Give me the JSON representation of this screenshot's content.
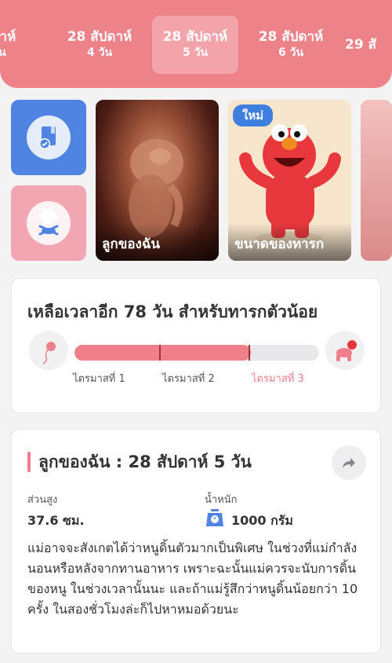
{
  "week_tabs": [
    {
      "line1": "ปดาห์",
      "line2": "วัน"
    },
    {
      "line1": "28 สัปดาห์",
      "line2": "4 วัน"
    },
    {
      "line1": "28 สัปดาห์",
      "line2": "5 วัน"
    },
    {
      "line1": "28 สัปดาห์",
      "line2": "6 วัน"
    },
    {
      "line1": "29 สั",
      "line2": ""
    }
  ],
  "active_tab_index": 2,
  "cards": {
    "fetus_caption": "ลูกของฉัน",
    "size_caption": "ขนาดของทารก",
    "new_badge": "ใหม่"
  },
  "countdown": {
    "title": "เหลือเวลาอีก 78 วัน สำหรับทารกตัวน้อย",
    "trimesters": [
      "ไตรมาสที่ 1",
      "ไตรมาสที่ 2",
      "ไตรมาสที่ 3"
    ],
    "progress_fraction": 0.72,
    "current_trimester_index": 2
  },
  "info": {
    "heading": "ลูกของฉัน : 28 สัปดาห์ 5  วัน",
    "height_label": "ส่วนสูง",
    "height_value": "37.6 ซม.",
    "weight_label": "น้ำหนัก",
    "weight_value": "1000 กรัม",
    "description": "แม่อาจจะสังเกตได้ว่าหนูดิ้นตัวมากเป็นพิเศษ ในช่วงที่แม่กำลังนอนหรือหลังจากทานอาหาร เพราะฉะนั้นแม่ควรจะนับการดิ้นของหนู ในช่วงเวลานั้นนะ และถ้าแม่รู้สึกว่าหนูดิ้นน้อยกว่า 10 ครั้ง ในสองชั่วโมงล่ะก็ไปหาหมอด้วยนะ"
  },
  "colors": {
    "accent": "#ee8289",
    "blue": "#4f84e2",
    "pink_tile": "#f1a6b2"
  }
}
